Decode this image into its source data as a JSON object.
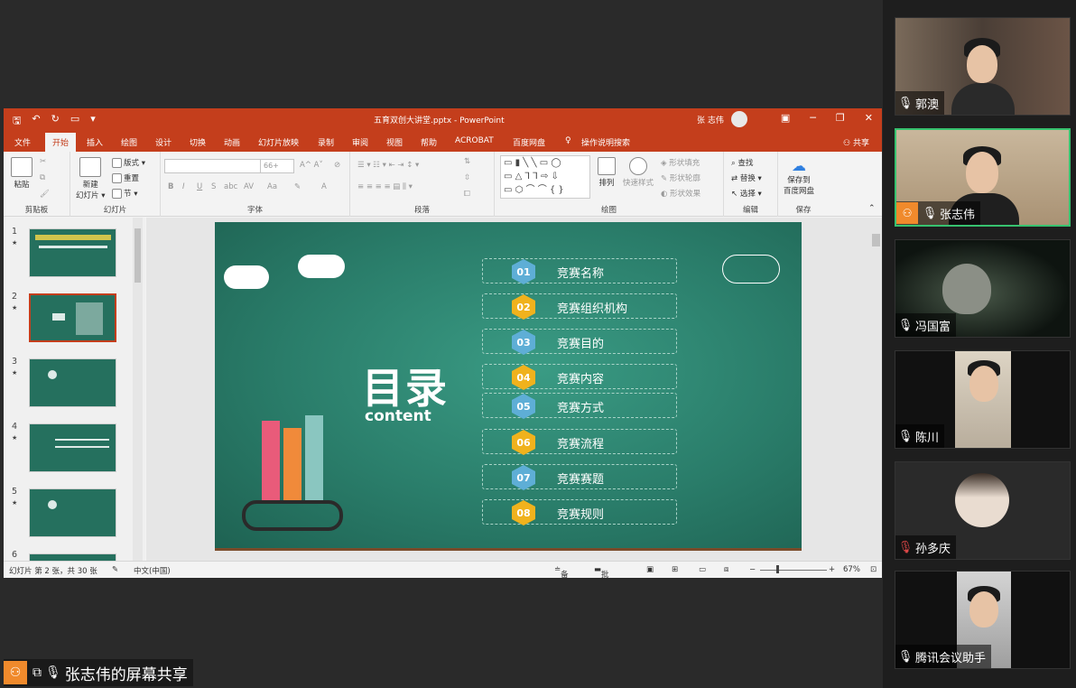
{
  "window": {
    "title": "五育双创大讲堂.pptx - PowerPoint",
    "user": "张 志伟"
  },
  "tabs": [
    "文件",
    "开始",
    "插入",
    "绘图",
    "设计",
    "切换",
    "动画",
    "幻灯片放映",
    "录制",
    "审阅",
    "视图",
    "帮助",
    "ACROBAT",
    "百度网盘"
  ],
  "search_hint": "操作说明搜索",
  "share_button": "共享",
  "ribbon": {
    "clipboard": {
      "label": "剪贴板",
      "paste": "粘贴"
    },
    "slides": {
      "label": "幻灯片",
      "new": "新建",
      "new2": "幻灯片",
      "layout": "版式",
      "reset": "重置",
      "section": "节"
    },
    "font": {
      "label": "字体",
      "size": "66+"
    },
    "paragraph": {
      "label": "段落"
    },
    "drawing": {
      "label": "绘图",
      "arrange": "排列",
      "quick_styles": "快速样式",
      "fill": "形状填充",
      "outline": "形状轮廓",
      "effects": "形状效果"
    },
    "editing": {
      "label": "编辑",
      "find": "查找",
      "replace": "替换",
      "select": "选择"
    },
    "save": {
      "label": "保存",
      "save_to": "保存到",
      "baidu": "百度网盘"
    }
  },
  "thumbnails": [
    "1",
    "2",
    "3",
    "4",
    "5",
    "6"
  ],
  "slide": {
    "title": "目录",
    "subtitle": "content",
    "items": [
      {
        "num": "01",
        "label": "竞赛名称",
        "color": "blue"
      },
      {
        "num": "02",
        "label": "竞赛组织机构",
        "color": "gold"
      },
      {
        "num": "03",
        "label": "竞赛目的",
        "color": "blue"
      },
      {
        "num": "04",
        "label": "竞赛内容",
        "color": "gold"
      },
      {
        "num": "05",
        "label": "竞赛方式",
        "color": "blue"
      },
      {
        "num": "06",
        "label": "竞赛流程",
        "color": "gold"
      },
      {
        "num": "07",
        "label": "竞赛赛题",
        "color": "blue"
      },
      {
        "num": "08",
        "label": "竞赛规则",
        "color": "gold"
      }
    ]
  },
  "status": {
    "slide_info": "幻灯片 第 2 张，共 30 张",
    "language": "中文(中国)",
    "notes": "备注",
    "comments": "批注",
    "zoom": "67%"
  },
  "share_label": "张志伟的屏幕共享",
  "participants": [
    "郭澳",
    "张志伟",
    "冯国富",
    "陈川",
    "孙多庆",
    "腾讯会议助手"
  ]
}
